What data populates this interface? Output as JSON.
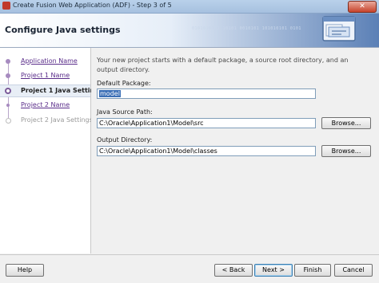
{
  "window": {
    "title": "Create Fusion Web Application (ADF) - Step 3 of 5",
    "close_label": "✕"
  },
  "header": {
    "title": "Configure Java settings",
    "binary_decoration": "0101010101 10101 0010101 101010101 0101"
  },
  "nav": {
    "items": [
      {
        "label": "Application Name",
        "state": "link"
      },
      {
        "label": "Project 1 Name",
        "state": "link"
      },
      {
        "label": "Project 1 Java Settings",
        "state": "current"
      },
      {
        "label": "Project 2 Name",
        "state": "link"
      },
      {
        "label": "Project 2 Java Settings",
        "state": "disabled"
      }
    ]
  },
  "content": {
    "intro": "Your new project starts with a default package, a source root directory, and an output directory.",
    "default_package": {
      "label": "Default Package:",
      "value": "model"
    },
    "java_source_path": {
      "label": "Java Source Path:",
      "value": "C:\\Oracle\\Application1\\Model\\src",
      "browse_label": "Browse..."
    },
    "output_directory": {
      "label": "Output Directory:",
      "value": "C:\\Oracle\\Application1\\Model\\classes",
      "browse_label": "Browse..."
    }
  },
  "footer": {
    "help": "Help",
    "back": "< Back",
    "next": "Next >",
    "finish": "Finish",
    "cancel": "Cancel"
  }
}
